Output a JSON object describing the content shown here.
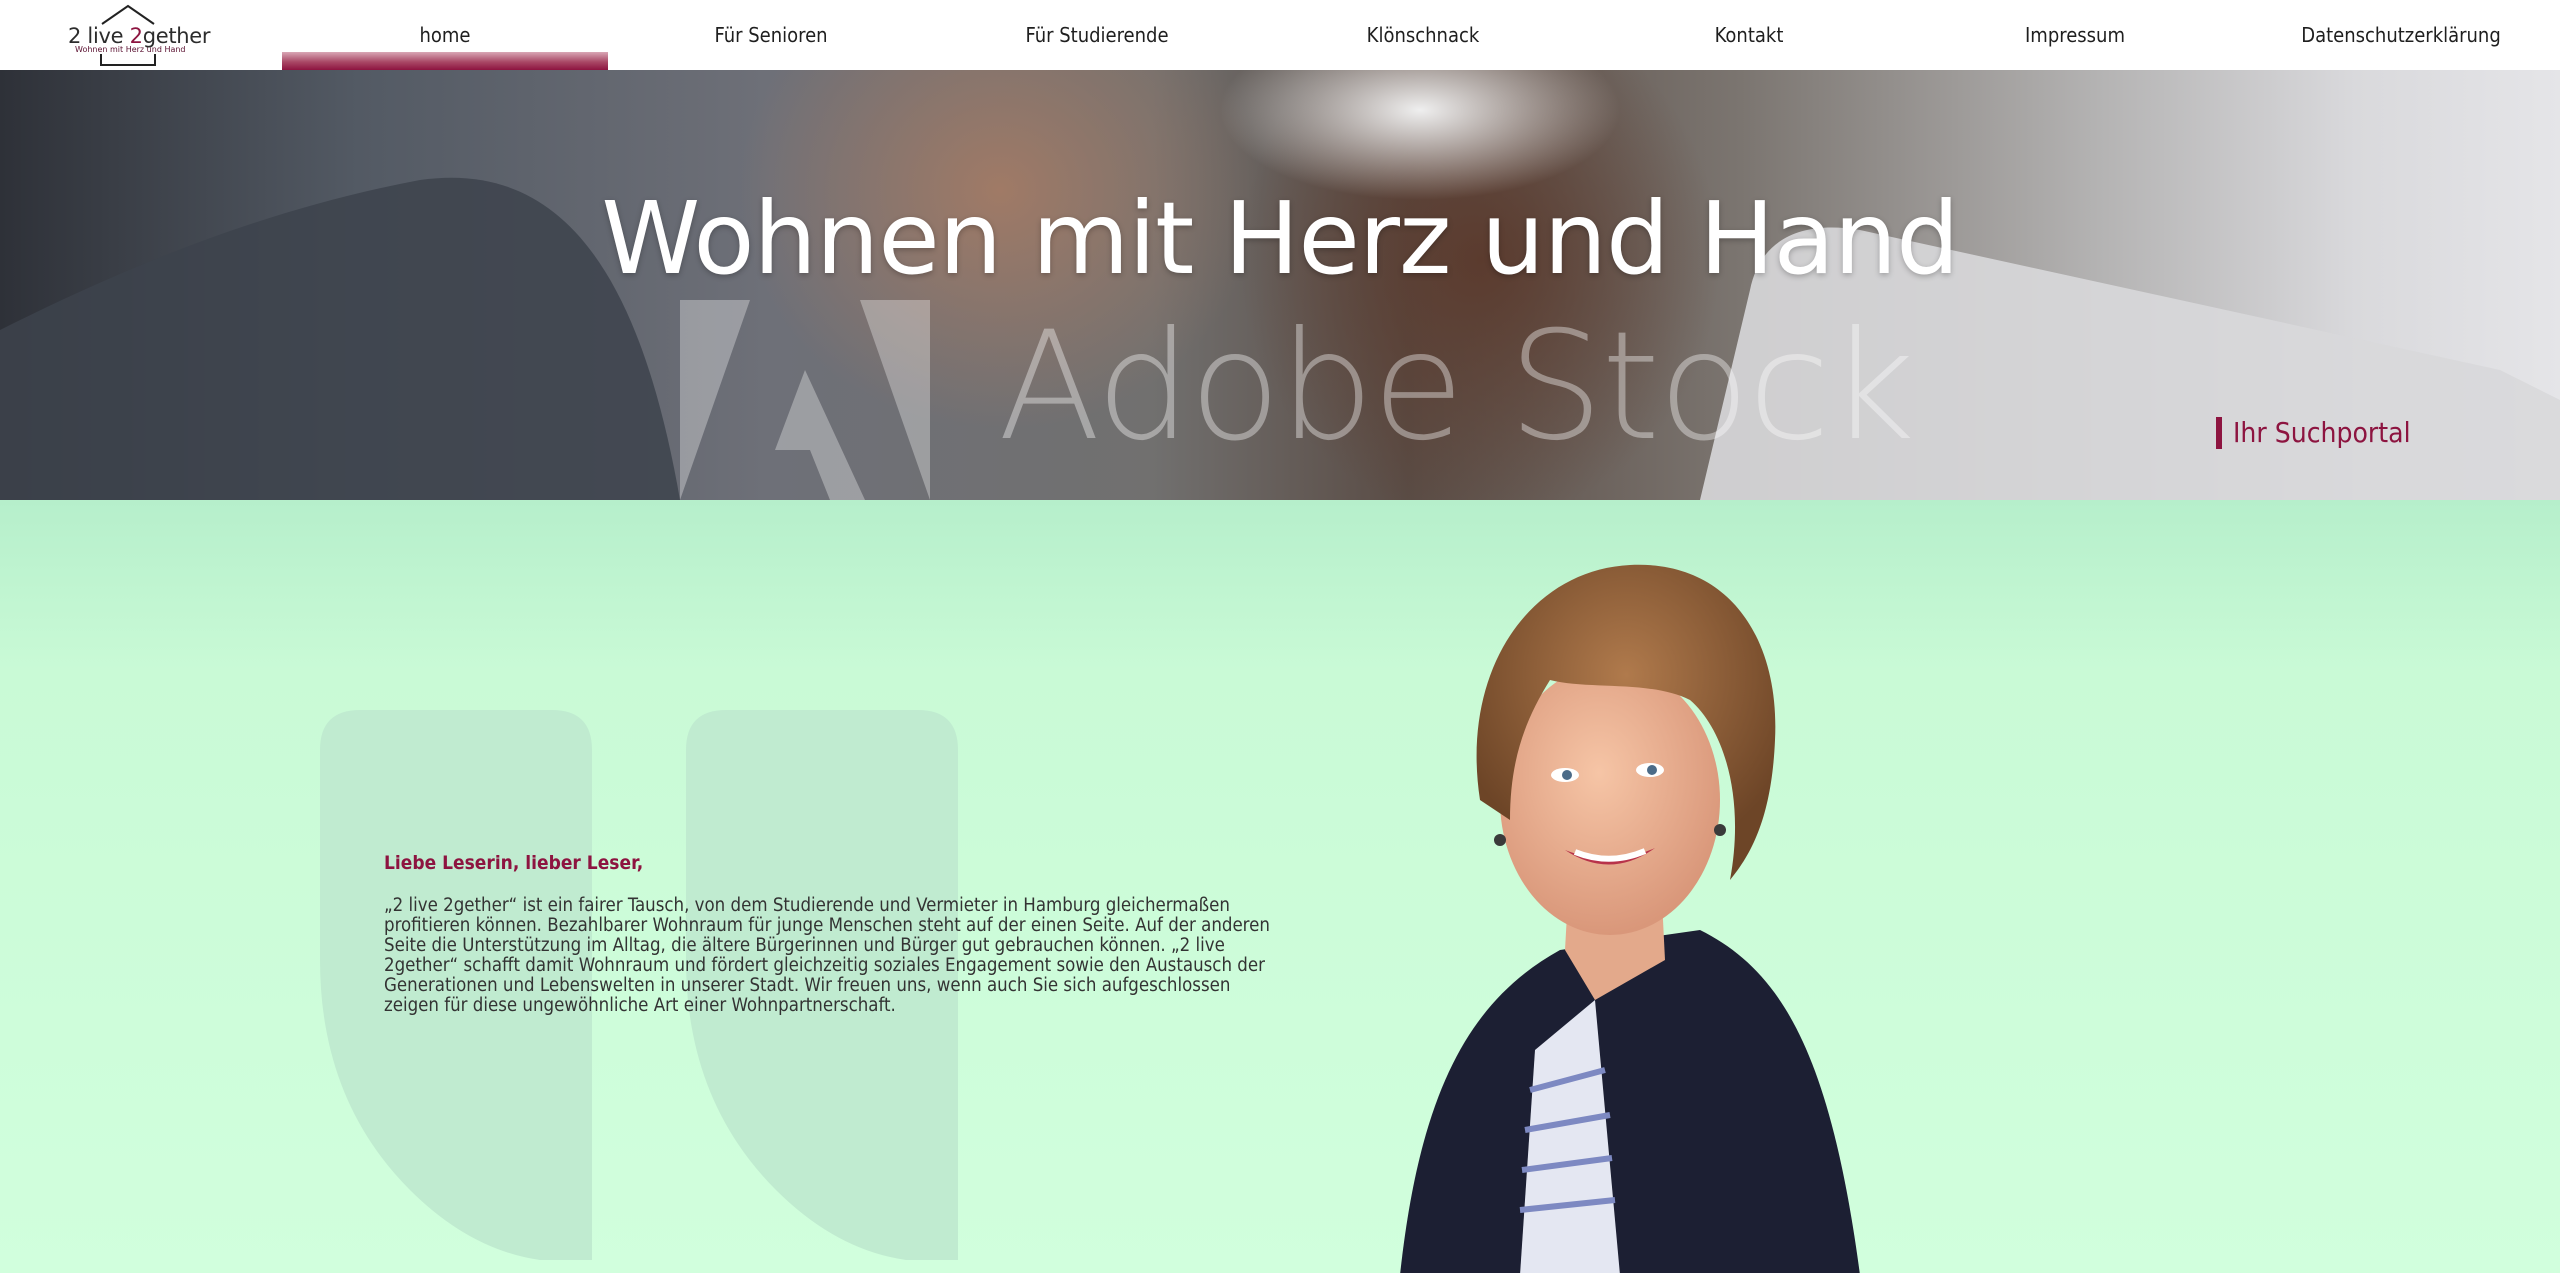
{
  "header": {
    "logo": {
      "name_prefix": "2 live ",
      "name_accent": "2",
      "name_suffix": "gether",
      "tagline": "Wohnen mit Herz und Hand"
    },
    "nav": [
      {
        "label": "home",
        "active": true
      },
      {
        "label": "Für Senioren",
        "active": false
      },
      {
        "label": "Für Studierende",
        "active": false
      },
      {
        "label": "Klönschnack",
        "active": false
      },
      {
        "label": "Kontakt",
        "active": false
      },
      {
        "label": "Impressum",
        "active": false
      },
      {
        "label": "Datenschutzerklärung",
        "active": false
      }
    ]
  },
  "hero": {
    "title": "Wohnen mit Herz und Hand",
    "watermark": "Adobe Stock",
    "portal_link": "Ihr Suchportal"
  },
  "main": {
    "greeting": "Liebe Leserin, lieber Leser,",
    "body": "„2 live 2gether“ ist ein fairer Tausch, von dem Studierende und Vermieter in Hamburg gleichermaßen profitieren können. Bezahlbarer Wohnraum für junge Menschen steht auf der einen Seite. Auf der anderen Seite die Unterstützung im Alltag, die ältere Bürgerinnen und Bürger gut gebrauchen können. „2 live 2gether“ schafft damit Wohnraum und fördert gleichzeitig soziales Engagement sowie den Austausch der Generationen und Lebenswelten in unserer Stadt. Wir freuen uns, wenn auch Sie sich aufgeschlossen zeigen für diese ungewöhnliche Art einer Wohnpartnerschaft."
  },
  "colors": {
    "accent": "#8d1440",
    "content_bg": "#d1ffdd",
    "quote_mark": "#c0ebd0"
  },
  "icons": {
    "logo": "house-roof-icon",
    "quote": "quotation-mark-icon",
    "watermark": "adobe-logo-icon"
  }
}
